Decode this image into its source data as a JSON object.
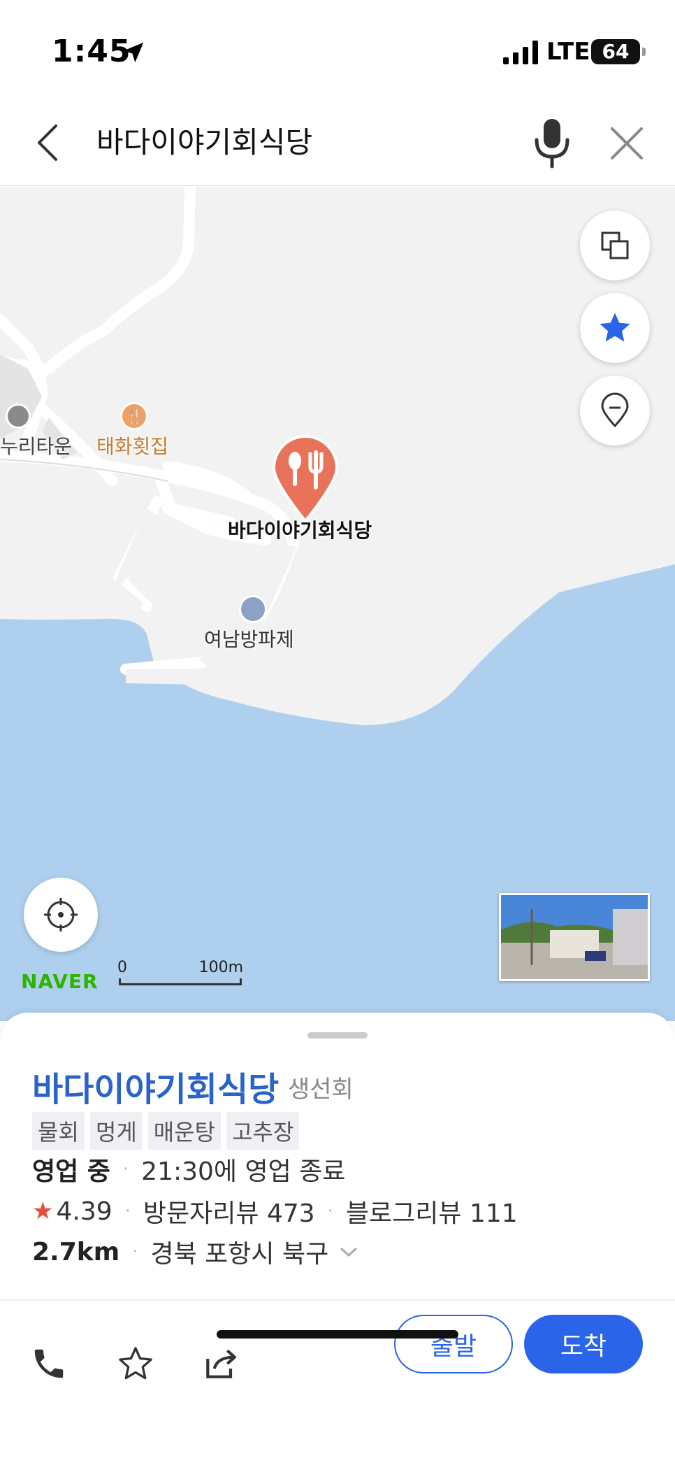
{
  "status_bar": {
    "time": "1:45",
    "network": "LTE",
    "battery": "64"
  },
  "search": {
    "query": "바다이야기회식당"
  },
  "map": {
    "labels": {
      "selected_place": "바다이야기회식당",
      "restaurant_poi": "태화횟집",
      "town_poi": "누리타운",
      "pier_poi": "여남방파제"
    },
    "scale": {
      "zero": "0",
      "distance": "100m"
    },
    "logo": "NAVER",
    "colors": {
      "land": "#f2f2f2",
      "water": "#aed0ee",
      "road": "#ffffff",
      "pin": "#e8735a"
    }
  },
  "place": {
    "name": "바다이야기회식당",
    "category": "생선회",
    "tags": [
      "물회",
      "멍게",
      "매운탕",
      "고추장"
    ],
    "status": "영업 중",
    "hours": "21:30에 영업 종료",
    "rating": "4.39",
    "visitor_reviews": "방문자리뷰 473",
    "blog_reviews": "블로그리뷰 111",
    "distance": "2.7km",
    "address": "경북 포항시 북구"
  },
  "actions": {
    "depart_label": "출발",
    "arrive_label": "도착",
    "accent": "#2a64e8"
  }
}
